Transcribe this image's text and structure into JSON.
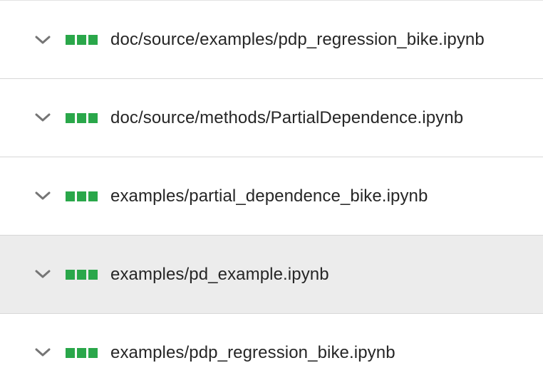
{
  "files": [
    {
      "path": "doc/source/examples/pdp_regression_bike.ipynb",
      "status": "passed"
    },
    {
      "path": "doc/source/methods/PartialDependence.ipynb",
      "status": "passed"
    },
    {
      "path": "examples/partial_dependence_bike.ipynb",
      "status": "passed"
    },
    {
      "path": "examples/pd_example.ipynb",
      "status": "passed",
      "highlighted": true
    },
    {
      "path": "examples/pdp_regression_bike.ipynb",
      "status": "passed"
    }
  ],
  "colors": {
    "status_passed": "#2aa74a",
    "highlight_row": "#ececec",
    "text": "#262626",
    "chevron": "#757575"
  },
  "icons": {
    "expand": "chevron-down-icon",
    "status": "status-bars-icon"
  }
}
